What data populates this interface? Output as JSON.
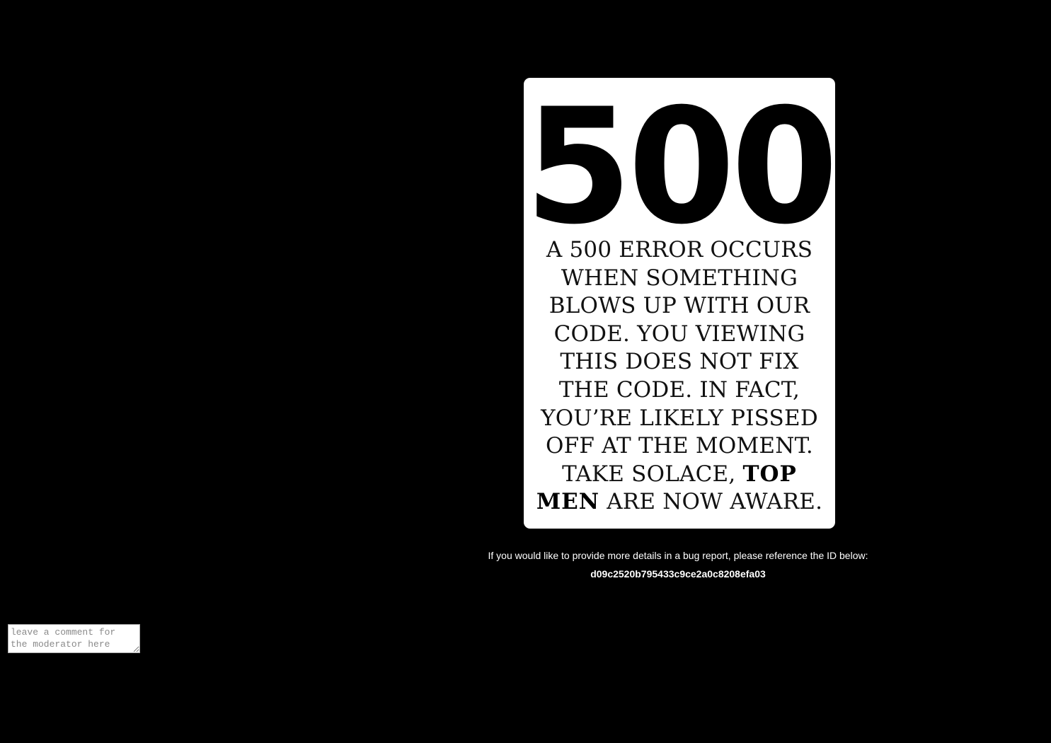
{
  "error": {
    "code": "500",
    "message_lines": [
      "A 500 ERROR OCCURS",
      "WHEN SOMETHING",
      "BLOWS UP WITH OUR",
      "CODE. YOU VIEWING",
      "THIS DOES NOT FIX",
      "THE CODE. IN FACT,",
      "YOU’RE LIKELY PISSED",
      "OFF AT THE MOMENT."
    ],
    "line9_prefix": "TAKE SOLACE, ",
    "bold_top": "TOP",
    "bold_men": "MEN",
    "line10_suffix": " ARE NOW AWARE."
  },
  "report": {
    "note": "If you would like to provide more details in a bug report, please reference the ID below:",
    "id": "d09c2520b795433c9ce2a0c8208efa03"
  },
  "comment": {
    "placeholder": "leave a comment for the moderator here",
    "value": ""
  },
  "colors": {
    "background": "#000000",
    "card": "#ffffff",
    "text_on_dark": "#ffffff"
  }
}
